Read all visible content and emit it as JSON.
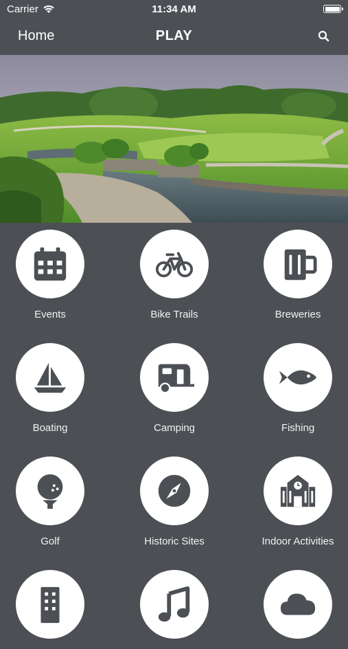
{
  "status_bar": {
    "carrier": "Carrier",
    "time": "11:34 AM"
  },
  "nav": {
    "home_label": "Home",
    "title": "PLAY",
    "search_icon": "search-icon"
  },
  "hero": {
    "image": "golf-course-pond-photo"
  },
  "colors": {
    "background": "#4c4f54",
    "icon": "#4c4f54",
    "circle": "#ffffff"
  },
  "tiles": [
    {
      "label": "Events",
      "icon": "calendar-icon"
    },
    {
      "label": "Bike Trails",
      "icon": "bicycle-icon"
    },
    {
      "label": "Breweries",
      "icon": "beer-mug-icon"
    },
    {
      "label": "Boating",
      "icon": "sailboat-icon"
    },
    {
      "label": "Camping",
      "icon": "camper-trailer-icon"
    },
    {
      "label": "Fishing",
      "icon": "fish-icon"
    },
    {
      "label": "Golf",
      "icon": "golf-ball-icon"
    },
    {
      "label": "Historic Sites",
      "icon": "compass-icon"
    },
    {
      "label": "Indoor Activities",
      "icon": "building-icon"
    },
    {
      "label": "",
      "icon": "hotel-icon"
    },
    {
      "label": "",
      "icon": "music-note-icon"
    },
    {
      "label": "",
      "icon": "cloud-icon"
    }
  ]
}
